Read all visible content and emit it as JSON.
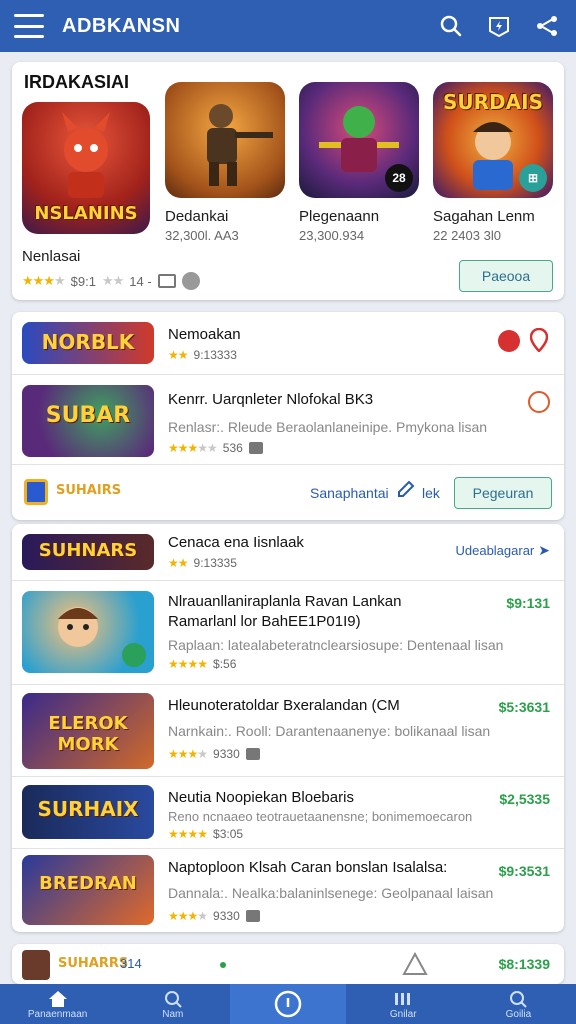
{
  "appbar": {
    "title": "ADBKANSN"
  },
  "featured": {
    "heading": "IRDAKASIAI",
    "games": [
      {
        "logo": "NSLANINS",
        "name": "Nenlasai",
        "rating_text": "$9:1",
        "extra": "14 -",
        "badge": ""
      },
      {
        "logo": "",
        "name": "Dedankai",
        "sub": "32,300l. AA3",
        "badge": ""
      },
      {
        "logo": "",
        "name": "Plegenaann",
        "sub": "23,300.934",
        "badge": "28"
      },
      {
        "logo": "SURDAIS",
        "name": "Sagahan Lenm",
        "sub": "22 2403 3l0",
        "badge": ""
      }
    ],
    "button_label": "Paeooa"
  },
  "section1": {
    "rows": [
      {
        "logo": "NORBLK",
        "title": "Nemoakan",
        "rating_text": "9:13333"
      },
      {
        "logo": "SUBAR",
        "title": "Kenrr. Uarqnleter Nlofokal BK3",
        "desc": "Renlasr:. Rleude Beraolanlaneinipe. Pmykona lisan",
        "rating_text": "536"
      }
    ],
    "footer_label": "Sanaphantai",
    "footer_extra": "lek",
    "footer_button": "Pegeuran",
    "footer_logo": "SUHAIRS"
  },
  "section2": {
    "rows": [
      {
        "logo": "SUHNARS",
        "title": "Cenaca ena Iisnlaak",
        "rating_text": "9:13335",
        "price": "Udeablagarar"
      },
      {
        "logo": "",
        "title": "Nlrauanllaniraplanla Ravan Lankan",
        "title2": "Ramarlanl lor BahEE1P01I9)",
        "desc": "Raplaan: latealabeteratnclearsiosupe: Dentenaal lisan",
        "rating_text": "$:56",
        "price": "$9:131"
      },
      {
        "logo": "ELEROK MORK",
        "title": "Hleunoteratoldar Bxeralandan (CM",
        "desc": "Narnkain:. Rooll: Darantenaanenye: bolikanaal lisan",
        "rating_text": "9330",
        "price": "$5:3631"
      },
      {
        "logo": "SURHAIX",
        "title": "Neutia Noopiekan Bloebaris",
        "desc": "Reno ncnaaeo teotrauetaanensne; bonimemoecaron",
        "rating_text": "$3:05",
        "price": "$2,5335"
      },
      {
        "logo": "BREDRAN",
        "title": "Naptoploon Klsah Caran bonslan Isalalsa:",
        "desc": "Dannala:. Nealka:balaninlsenege: Geolpanaal laisan",
        "rating_text": "9330",
        "price": "$9:3531"
      }
    ]
  },
  "section3": {
    "logo": "SUHARRS",
    "count": "314",
    "price": "$8:1339"
  },
  "bottomnav": {
    "items": [
      "Panaenmaan",
      "Nam",
      "",
      "Gnilar",
      "Goilia"
    ]
  },
  "colors": {
    "appbar": "#2f5fb3",
    "price": "#2aa04a",
    "star": "#f2b400"
  }
}
